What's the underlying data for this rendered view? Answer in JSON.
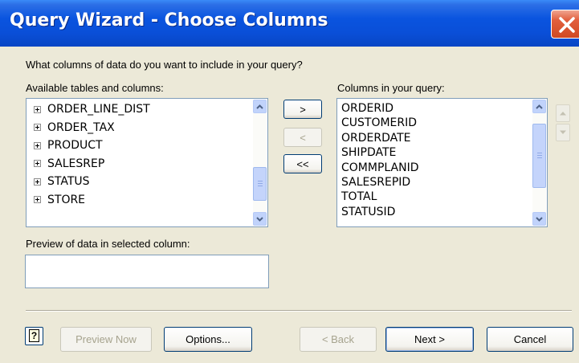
{
  "window": {
    "title": "Query Wizard - Choose Columns"
  },
  "question": "What columns of data do you want to include in your query?",
  "available": {
    "label": "Available tables and columns:",
    "items": [
      "ORDER_LINE_DIST",
      "ORDER_TAX",
      "PRODUCT",
      "SALESREP",
      "STATUS",
      "STORE"
    ]
  },
  "move": {
    "add": ">",
    "remove": "<",
    "remove_all": "<<"
  },
  "selected": {
    "label": "Columns in your query:",
    "items": [
      "ORDERID",
      "CUSTOMERID",
      "ORDERDATE",
      "SHIPDATE",
      "COMMPLANID",
      "SALESREPID",
      "TOTAL",
      "STATUSID"
    ]
  },
  "preview": {
    "label": "Preview of data in selected column:",
    "value": ""
  },
  "buttons": {
    "preview_now": "Preview Now",
    "options": "Options...",
    "back": "< Back",
    "next": "Next >",
    "cancel": "Cancel"
  },
  "colors": {
    "titlebar": "#0A54DF",
    "dialog_bg": "#ECE9D8",
    "close": "#D04A23"
  }
}
